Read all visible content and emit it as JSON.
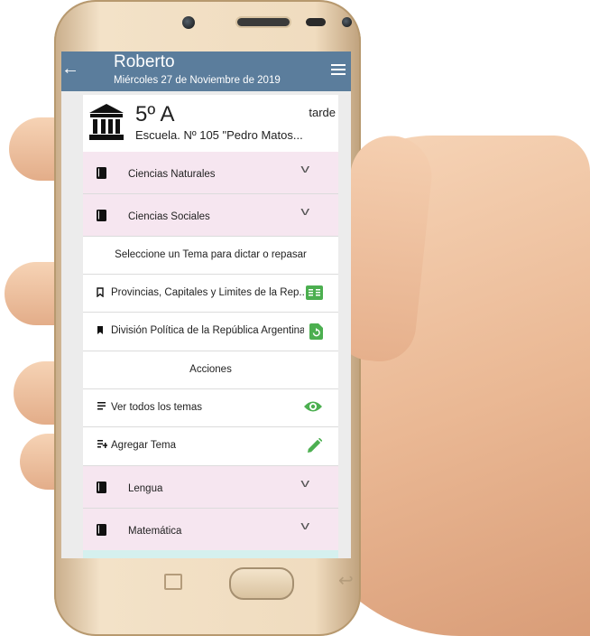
{
  "appbar": {
    "user": "Roberto",
    "date": "Miércoles 27 de Noviembre de 2019"
  },
  "class": {
    "grade": "5º A",
    "school": "Escuela. Nº 105 \"Pedro Matos...",
    "shift": "tarde"
  },
  "subjects_top": [
    {
      "label": "Ciencias Naturales"
    },
    {
      "label": "Ciencias Sociales"
    }
  ],
  "topics": {
    "prompt": "Seleccione un Tema para dictar o repasar",
    "items": [
      {
        "label": "Provincias, Capitales y Limites de la Rep..."
      },
      {
        "label": "División Política de la República Argentina"
      }
    ]
  },
  "actions": {
    "heading": "Acciones",
    "items": [
      {
        "label": "Ver todos los temas"
      },
      {
        "label": "Agregar Tema"
      }
    ]
  },
  "subjects_bottom": [
    {
      "label": "Lengua"
    },
    {
      "label": "Matemática"
    }
  ],
  "colors": {
    "appbar": "#5b7d9c",
    "subject_bg": "#f6e6f0",
    "accent_green": "#4caf50"
  }
}
